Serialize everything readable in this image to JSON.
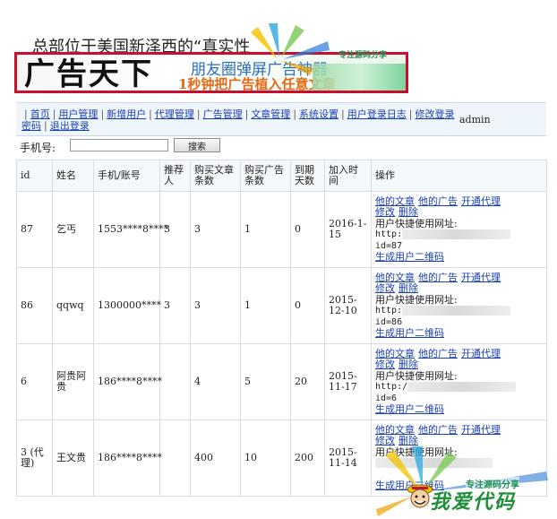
{
  "headline": "总部位于美国新泽西的“真实性",
  "banner": {
    "brand": "广告天下",
    "line1": "朋友圈弹屏广告神器",
    "line2": "1秒钟把广告植入任意文章"
  },
  "watermark_top": "专注源码分享",
  "nav": {
    "items": [
      "首页",
      "用户管理",
      "新增用户",
      "代理管理",
      "广告管理",
      "文章管理",
      "系统设置",
      "用户登录日志",
      "修改登录密码",
      "退出登录"
    ],
    "user": "admin"
  },
  "search": {
    "label": "手机号:",
    "value": "",
    "button": "搜索"
  },
  "table": {
    "headers": [
      "id",
      "姓名",
      "手机/账号",
      "推荐人",
      "购买文章条数",
      "购买广告条数",
      "到期天数",
      "加入时间",
      "操作"
    ],
    "actions": {
      "my_articles": "他的文章",
      "my_ads": "他的广告",
      "open_agent": "开通代理",
      "edit": "修改",
      "delete": "删除",
      "url_label": "用户快捷使用网址:",
      "qr": "生成用户二维码"
    },
    "rows": [
      {
        "id": "87",
        "name": "乞丐",
        "phone": "1553****8****",
        "referrer": "3",
        "articles": "3",
        "ads": "1",
        "days": "0",
        "joined": "2016-1-15",
        "url_prefix": "http:",
        "url_id": "id=87"
      },
      {
        "id": "86",
        "name": "qqwq",
        "phone": "1300000****",
        "referrer": "3",
        "articles": "3",
        "ads": "1",
        "days": "0",
        "joined": "2015-12-10",
        "url_prefix": "http:",
        "url_id": "id=86"
      },
      {
        "id": "6",
        "name": "阿贵阿贵",
        "phone": "186****8****",
        "referrer": "",
        "articles": "4",
        "ads": "5",
        "days": "20",
        "joined": "2015-11-17",
        "url_prefix": "http:/",
        "url_id": "id=6"
      },
      {
        "id": "3 (代理)",
        "name": "王文贵",
        "phone": "186****8****",
        "referrer": "",
        "articles": "400",
        "ads": "10",
        "days": "200",
        "joined": "2015-11-14",
        "url_prefix": "",
        "url_id": ""
      }
    ]
  },
  "watermark_bottom": {
    "sub": "专注源码分享",
    "big": "我爱代码"
  },
  "colors": {
    "link": "#1a3fb5",
    "banner_border": "#c8102e",
    "watermark_green": "#1f8f3a"
  }
}
